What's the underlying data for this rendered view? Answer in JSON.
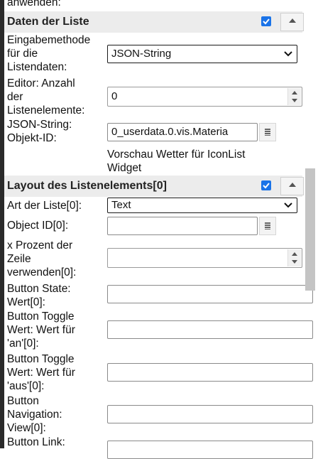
{
  "top_cut_text": "anwenden:",
  "section1": {
    "title": "Daten der Liste",
    "checked": true
  },
  "input_method": {
    "label": "Eingabemethode\nfür die\nListendaten:",
    "value": "JSON-String"
  },
  "editor_count": {
    "label": "Editor: Anzahl\nder\nListenelemente:",
    "value": "0"
  },
  "json_oid": {
    "label": "JSON-String:\nObjekt-ID:",
    "value": "0_userdata.0.vis.Materia"
  },
  "preview_text": "Vorschau Wetter für IconList\nWidget",
  "section2": {
    "title": "Layout des Listenelements[0]",
    "checked": true
  },
  "list_type": {
    "label": "Art der Liste[0]:",
    "value": "Text"
  },
  "object_id": {
    "label": "Object ID[0]:",
    "value": ""
  },
  "x_percent": {
    "label": "x Prozent der\nZeile\nverwenden[0]:",
    "value": ""
  },
  "button_state": {
    "label": "Button State:\nWert[0]:",
    "value": ""
  },
  "toggle_on": {
    "label": "Button Toggle\nWert: Wert für\n'an'[0]:",
    "value": ""
  },
  "toggle_off": {
    "label": "Button Toggle\nWert: Wert für\n'aus'[0]:",
    "value": ""
  },
  "nav_view": {
    "label": "Button\nNavigation:\nView[0]:",
    "value": ""
  },
  "button_link": {
    "label": "Button Link:",
    "value": ""
  }
}
